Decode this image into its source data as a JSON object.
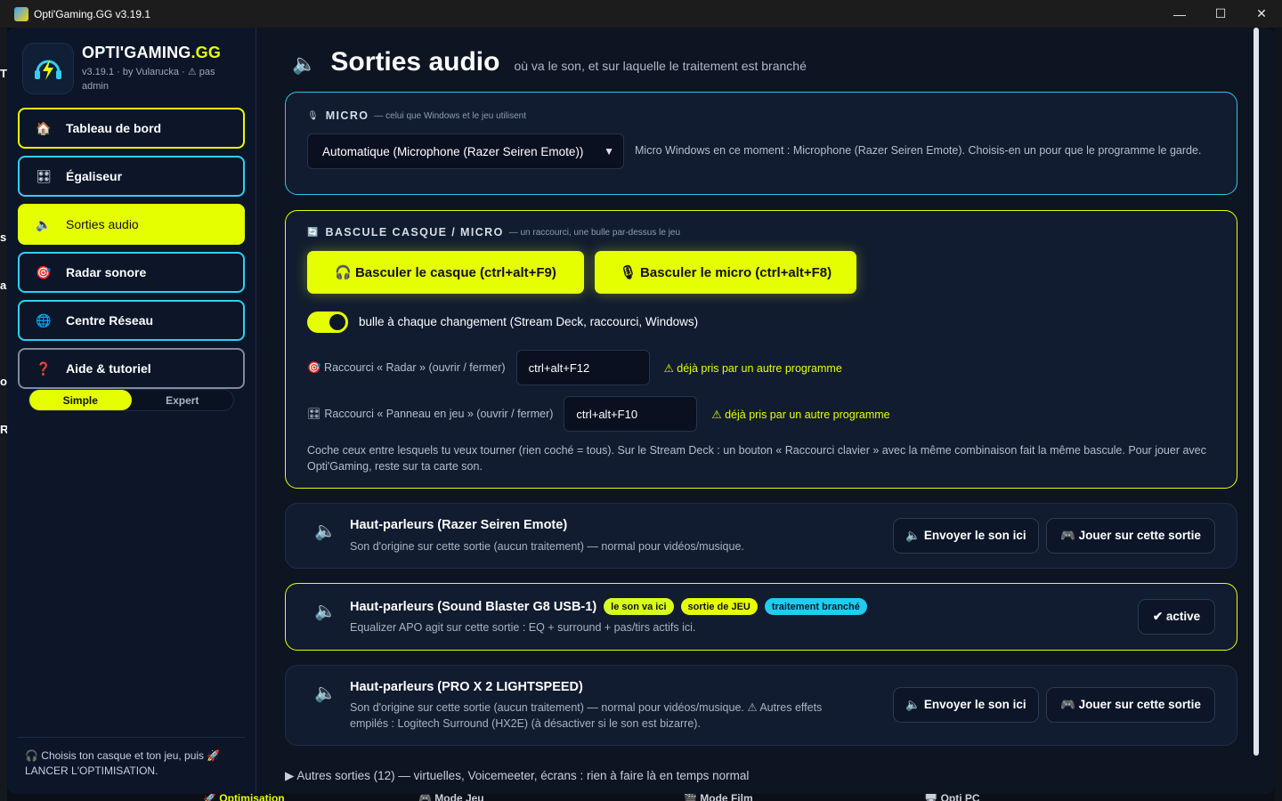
{
  "window": {
    "title": "Opti'Gaming.GG v3.19.1",
    "minimize": "—",
    "maximize": "☐",
    "close": "✕"
  },
  "brand": {
    "name": "OPTI'GAMING",
    "name_suffix": ".GG",
    "subtitle": "v3.19.1 · by Vularucka · ⚠ pas admin",
    "accent": "#e6ff00"
  },
  "nav": [
    {
      "label": "Tableau de bord",
      "icon": "house-icon",
      "glyph": "🏠"
    },
    {
      "label": "Égaliseur",
      "icon": "slider-icon",
      "glyph": "🎛"
    },
    {
      "label": "Sorties audio",
      "icon": "speaker-icon",
      "glyph": "🔈"
    },
    {
      "label": "Radar sonore",
      "icon": "target-icon",
      "glyph": "🎯"
    },
    {
      "label": "Centre Réseau",
      "icon": "globe-icon",
      "glyph": "🌐"
    },
    {
      "label": "Aide & tutoriel",
      "icon": "question-icon",
      "glyph": "❓"
    }
  ],
  "mode": {
    "simple": "Simple",
    "expert": "Expert",
    "selected": "Simple"
  },
  "sidebar_footer": "🎧 Choisis ton casque et ton jeu, puis 🚀 LANCER L'OPTIMISATION.",
  "page": {
    "title": "Sorties audio",
    "subtitle": "où va le son, et sur laquelle le traitement est branché"
  },
  "micro": {
    "title": "MICRO",
    "subtitle": "— celui que Windows et le jeu utilisent",
    "selected": "Automatique (Microphone (Razer Seiren Emote))",
    "note": "Micro Windows en ce moment : Microphone (Razer Seiren Emote). Choisis-en un pour que le programme le garde."
  },
  "toggle_section": {
    "title": "BASCULE CASQUE / MICRO",
    "subtitle": "— un raccourci, une bulle par-dessus le jeu",
    "btn_headset": "🎧 Basculer le casque (ctrl+alt+F9)",
    "btn_mic": "🎙 Basculer le micro (ctrl+alt+F8)",
    "bubble_switch_label": "bulle à chaque changement (Stream Deck, raccourci, Windows)",
    "bubble_switch_on": true,
    "shortcut_radar_label": "🎯 Raccourci « Radar » (ouvrir / fermer)",
    "shortcut_radar_value": "ctrl+alt+F12",
    "shortcut_panel_label": "🎛 Raccourci « Panneau en jeu » (ouvrir / fermer)",
    "shortcut_panel_value": "ctrl+alt+F10",
    "warning": "⚠ déjà pris par un autre programme",
    "note": "Coche ceux entre lesquels tu veux tourner (rien coché = tous). Sur le Stream Deck : un bouton « Raccourci clavier » avec la même combinaison fait la même bascule. Pour jouer avec Opti'Gaming, reste sur ta carte son."
  },
  "outputs": [
    {
      "title": "Haut-parleurs (Razer Seiren Emote)",
      "desc": "Son d'origine sur cette sortie (aucun traitement) — normal pour vidéos/musique.",
      "send_btn": "🔈 Envoyer le son ici",
      "play_btn": "🎮 Jouer sur cette sortie"
    },
    {
      "title": "Haut-parleurs (Sound Blaster G8 USB-1)",
      "badges": [
        "le son va ici",
        "sortie de JEU",
        "traitement branché"
      ],
      "desc": "Equalizer APO agit sur cette sortie : EQ + surround + pas/tirs actifs ici.",
      "active_btn": "✔ active"
    },
    {
      "title": "Haut-parleurs (PRO X 2 LIGHTSPEED)",
      "desc": "Son d'origine sur cette sortie (aucun traitement) — normal pour vidéos/musique. ⚠ Autres effets empilés : Logitech Surround (HX2E) (à désactiver si le son est bizarre).",
      "send_btn": "🔈 Envoyer le son ici",
      "play_btn": "🎮 Jouer sur cette sortie"
    }
  ],
  "more_outputs": "▶ Autres sorties (12) — virtuelles, Voicemeeter, écrans : rien à faire là en temps normal",
  "background_tabs": [
    "🚀 Optimisation",
    "🎮 Mode Jeu",
    "🎬 Mode Film",
    "🖥 Opti PC"
  ]
}
